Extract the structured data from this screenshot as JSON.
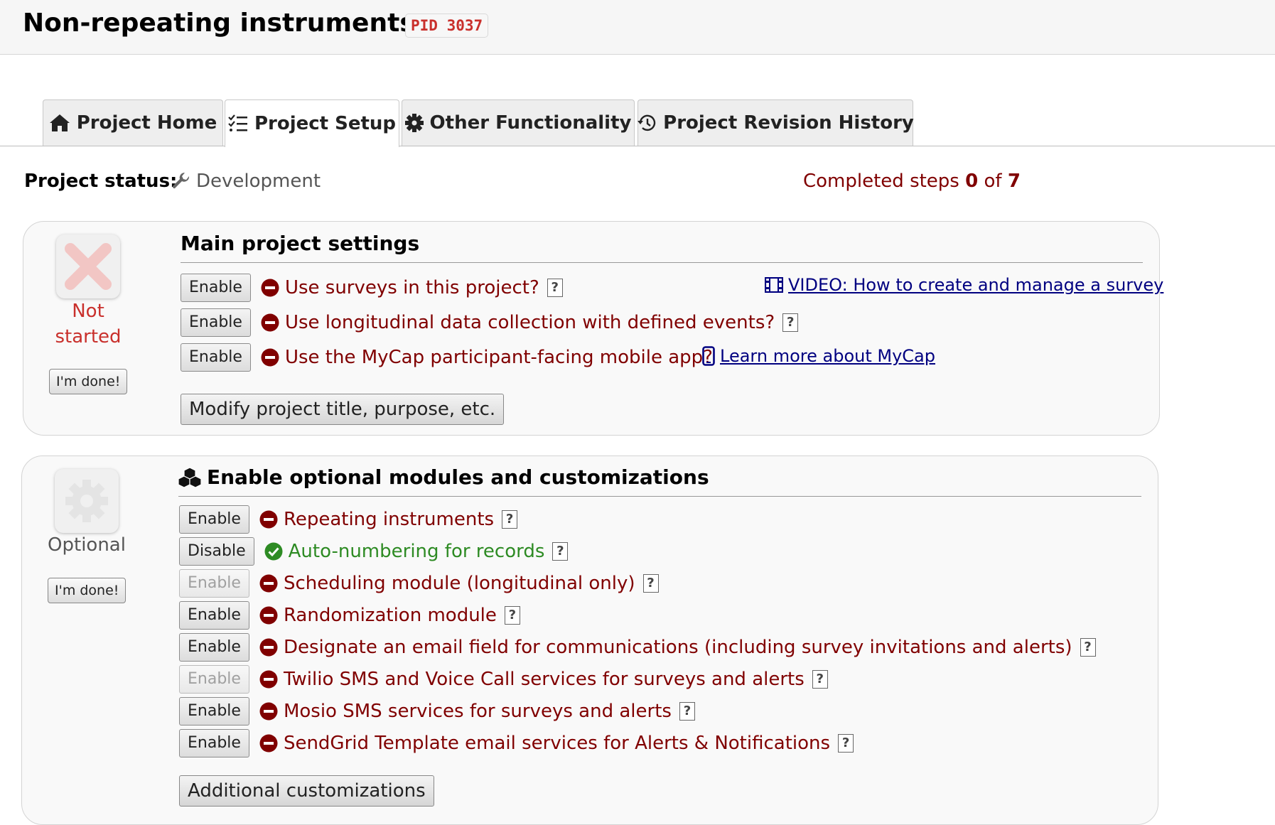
{
  "header": {
    "title": "Non-repeating instruments",
    "pid": "PID 3037"
  },
  "tabs": [
    {
      "label": "Project Home",
      "icon": "home-icon"
    },
    {
      "label": "Project Setup",
      "icon": "checklist-icon",
      "active": true
    },
    {
      "label": "Other Functionality",
      "icon": "gear-icon"
    },
    {
      "label": "Project Revision History",
      "icon": "history-icon"
    }
  ],
  "status": {
    "label": "Project status:",
    "value": "Development",
    "steps_prefix": "Completed steps ",
    "steps_done": "0",
    "steps_of": " of ",
    "steps_total": "7"
  },
  "main_panel": {
    "title": "Main project settings",
    "state_line1": "Not",
    "state_line2": "started",
    "state_color": "#c9302c",
    "done_label": "I'm done!",
    "rows": [
      {
        "button": "Enable",
        "label": "Use surveys in this project?",
        "help": "?"
      },
      {
        "button": "Enable",
        "label": "Use longitudinal data collection with defined events?",
        "help": "?"
      },
      {
        "button": "Enable",
        "label": "Use the MyCap participant-facing mobile app?"
      }
    ],
    "video_link": "VIDEO: How to create and manage a survey",
    "mycap_link": "Learn more about MyCap",
    "modify_button": "Modify project title, purpose, etc."
  },
  "optional_panel": {
    "title": "Enable optional modules and customizations",
    "state": "Optional",
    "done_label": "I'm done!",
    "rows": [
      {
        "button": "Enable",
        "label": "Repeating instruments",
        "help": "?",
        "status": "off"
      },
      {
        "button": "Disable",
        "label": "Auto-numbering for records",
        "help": "?",
        "status": "on"
      },
      {
        "button": "Enable",
        "label": "Scheduling module (longitudinal only)",
        "help": "?",
        "status": "off",
        "disabled": true
      },
      {
        "button": "Enable",
        "label": "Randomization module",
        "help": "?",
        "status": "off"
      },
      {
        "button": "Enable",
        "label": "Designate an email field for communications (including survey invitations and alerts)",
        "help": "?",
        "status": "off"
      },
      {
        "button": "Enable",
        "label": "Twilio SMS and Voice Call services for surveys and alerts",
        "help": "?",
        "status": "off",
        "disabled": true
      },
      {
        "button": "Enable",
        "label": "Mosio SMS services for surveys and alerts",
        "help": "?",
        "status": "off"
      },
      {
        "button": "Enable",
        "label": "SendGrid Template email services for Alerts & Notifications",
        "help": "?",
        "status": "off"
      }
    ],
    "additional_button": "Additional customizations"
  },
  "colors": {
    "disabled_status": "#800000",
    "enabled_status": "#2e8b24",
    "link": "#000080"
  }
}
